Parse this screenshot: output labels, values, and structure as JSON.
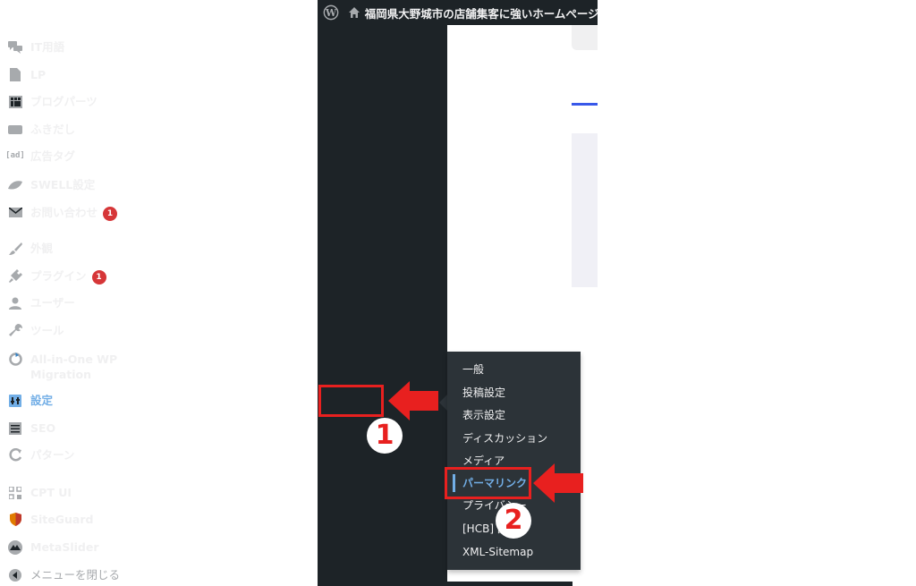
{
  "adminbar": {
    "site_title": "福岡県大野城市の店舗集客に強いホームページ制作"
  },
  "sidebar": {
    "items": [
      {
        "label": "IT用語",
        "icon": "comments-icon"
      },
      {
        "label": "LP",
        "icon": "page-icon"
      },
      {
        "label": "ブログパーツ",
        "icon": "blocks-icon"
      },
      {
        "label": "ふきだし",
        "icon": "speech-bubble-icon"
      },
      {
        "label": "広告タグ",
        "icon": "ad-tag-icon",
        "icon_text": "[ad]"
      },
      {
        "label": "SWELL設定",
        "icon": "swell-leaf-icon"
      },
      {
        "label": "お問い合わせ",
        "icon": "mail-icon",
        "badge": "1"
      },
      {
        "label": "外観",
        "icon": "paintbrush-icon"
      },
      {
        "label": "プラグイン",
        "icon": "plugin-icon",
        "badge": "1"
      },
      {
        "label": "ユーザー",
        "icon": "user-icon"
      },
      {
        "label": "ツール",
        "icon": "wrench-icon"
      },
      {
        "label": "All-in-One WP Migration",
        "icon": "migration-icon"
      },
      {
        "label": "設定",
        "icon": "settings-icon"
      },
      {
        "label": "SEO",
        "icon": "seo-icon"
      },
      {
        "label": "パターン",
        "icon": "pattern-icon"
      },
      {
        "label": "CPT UI",
        "icon": "cpt-ui-icon"
      },
      {
        "label": "SiteGuard",
        "icon": "shield-icon"
      },
      {
        "label": "MetaSlider",
        "icon": "metaslider-icon"
      },
      {
        "label": "メニューを閉じる",
        "icon": "collapse-menu-icon"
      }
    ]
  },
  "submenu": {
    "items": [
      {
        "label": "一般"
      },
      {
        "label": "投稿設定"
      },
      {
        "label": "表示設定"
      },
      {
        "label": "ディスカッション"
      },
      {
        "label": "メディア"
      },
      {
        "label": "パーマリンク"
      },
      {
        "label": "プライバシー"
      },
      {
        "label": "[HCB] 設定"
      },
      {
        "label": "XML-Sitemap"
      }
    ]
  },
  "annotations": {
    "step1": "1",
    "step2": "2"
  },
  "colors": {
    "sidebar_bg": "#1d2327",
    "submenu_bg": "#2c3338",
    "accent": "#72aee6",
    "badge": "#d63638",
    "annotation_red": "#e8201f"
  }
}
